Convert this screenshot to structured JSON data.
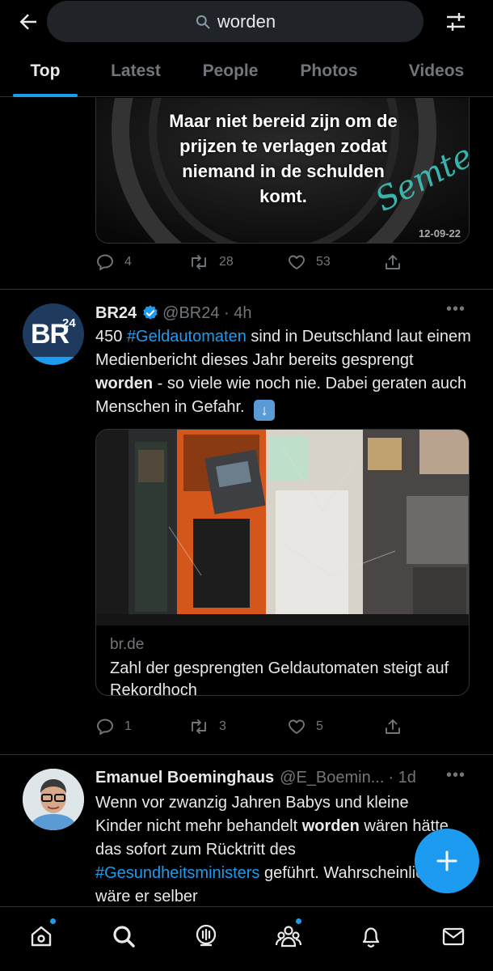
{
  "search": {
    "query": "worden"
  },
  "tabs": [
    {
      "label": "Top",
      "active": true
    },
    {
      "label": "Latest"
    },
    {
      "label": "People"
    },
    {
      "label": "Photos"
    },
    {
      "label": "Videos"
    }
  ],
  "tweet1": {
    "image_text_lines": [
      "Maar niet bereid zijn om de",
      "prijzen te verlagen zodat",
      "niemand in de schulden",
      "komt."
    ],
    "image_signature": "Semtex",
    "image_date": "12-09-22",
    "replies": "4",
    "retweets": "28",
    "likes": "53"
  },
  "tweet2": {
    "avatar_text": "BR",
    "avatar_sup": "24",
    "name": "BR24",
    "verified": true,
    "handle_time": "@BR24 · 4h",
    "text_pre": "450 ",
    "hashtag": "#Geldautomaten",
    "text_mid": " sind in Deutschland laut einem Medienbericht dieses Jahr bereits gesprengt ",
    "bold_word": "worden",
    "text_post": " - so viele wie noch nie. Dabei geraten auch Menschen in Gefahr.",
    "emoji": "⬇️",
    "card_domain": "br.de",
    "card_title": "Zahl der gesprengten Geldautomaten steigt auf Rekordhoch",
    "replies": "1",
    "retweets": "3",
    "likes": "5"
  },
  "tweet3": {
    "name": "Emanuel Boeminghaus",
    "handle": "@E_Boemin...",
    "time": "· 1d",
    "text_pre": "Wenn vor zwanzig Jahren Babys und kleine Kinder nicht mehr behandelt ",
    "bold_word": "worden",
    "text_mid": " wären hätte das sofort zum Rücktritt des ",
    "hashtag": "#Gesundheitsministers",
    "text_post": " geführt. Wahrscheinlich wäre er selber"
  },
  "nav": [
    "home-icon",
    "search-icon",
    "spaces-icon",
    "communities-icon",
    "notifications-icon",
    "messages-icon"
  ],
  "colors": {
    "accent": "#1d9bf0",
    "bg": "#000000",
    "muted": "#71767b",
    "text": "#e7e9ea",
    "border": "#2f3336"
  }
}
